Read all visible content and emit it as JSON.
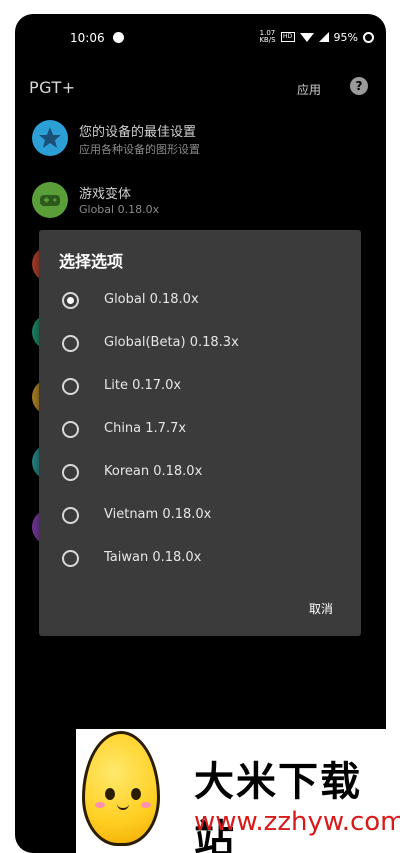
{
  "status_bar": {
    "time": "10:06",
    "net_speed": "1.07",
    "net_unit": "KB/S",
    "sim_label": "HD",
    "battery": "95%"
  },
  "app_bar": {
    "title": "PGT+",
    "apply_label": "应用",
    "help_glyph": "?"
  },
  "list": {
    "items": [
      {
        "title": "您的设备的最佳设置",
        "subtitle": "应用各种设备的图形设置",
        "icon": "star-icon",
        "color": "#2c9fd6"
      },
      {
        "title": "游戏变体",
        "subtitle": "Global 0.18.0x",
        "icon": "gamepad-icon",
        "color": "#5a9e3a"
      }
    ]
  },
  "dialog": {
    "title": "选择选项",
    "options": [
      {
        "label": "Global 0.18.0x",
        "selected": true
      },
      {
        "label": "Global(Beta) 0.18.3x",
        "selected": false
      },
      {
        "label": "Lite 0.17.0x",
        "selected": false
      },
      {
        "label": "China 1.7.7x",
        "selected": false
      },
      {
        "label": "Korean 0.18.0x",
        "selected": false
      },
      {
        "label": "Vietnam 0.18.0x",
        "selected": false
      },
      {
        "label": "Taiwan 0.18.0x",
        "selected": false
      }
    ],
    "cancel_label": "取消"
  },
  "watermark": {
    "brand_name": "大米下载站",
    "url": "www.zzhyw.com"
  }
}
